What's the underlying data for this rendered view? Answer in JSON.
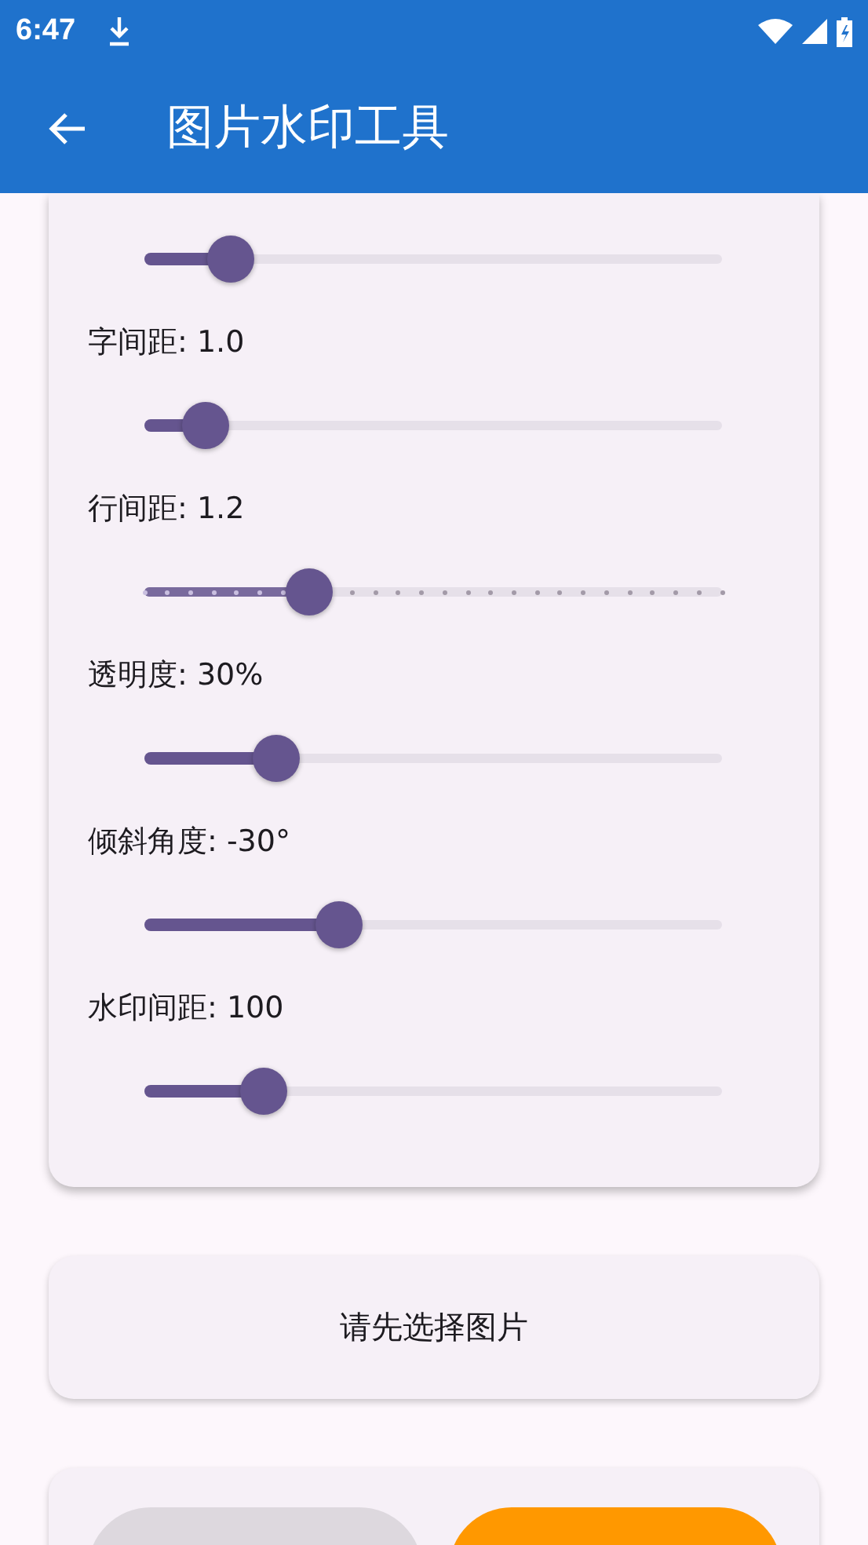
{
  "status_bar": {
    "time": "6:47"
  },
  "app_bar": {
    "title": "图片水印工具"
  },
  "sliders": [
    {
      "kind": "continuous",
      "level": 0.15
    },
    {
      "kind": "continuous",
      "label": "字间距: 1.0",
      "level": 0.106
    },
    {
      "kind": "discrete",
      "label": "行间距: 1.2",
      "level": 0.285
    },
    {
      "kind": "continuous",
      "label": "透明度: 30%",
      "level": 0.228
    },
    {
      "kind": "continuous",
      "label": "倾斜角度: -30°",
      "level": 0.337
    },
    {
      "kind": "continuous",
      "label": "水印间距: 100",
      "level": 0.207
    }
  ],
  "status_message": "请先选择图片",
  "bottom_buttons": [
    {
      "color": "#ddd8de"
    },
    {
      "color": "#ff9800"
    }
  ]
}
